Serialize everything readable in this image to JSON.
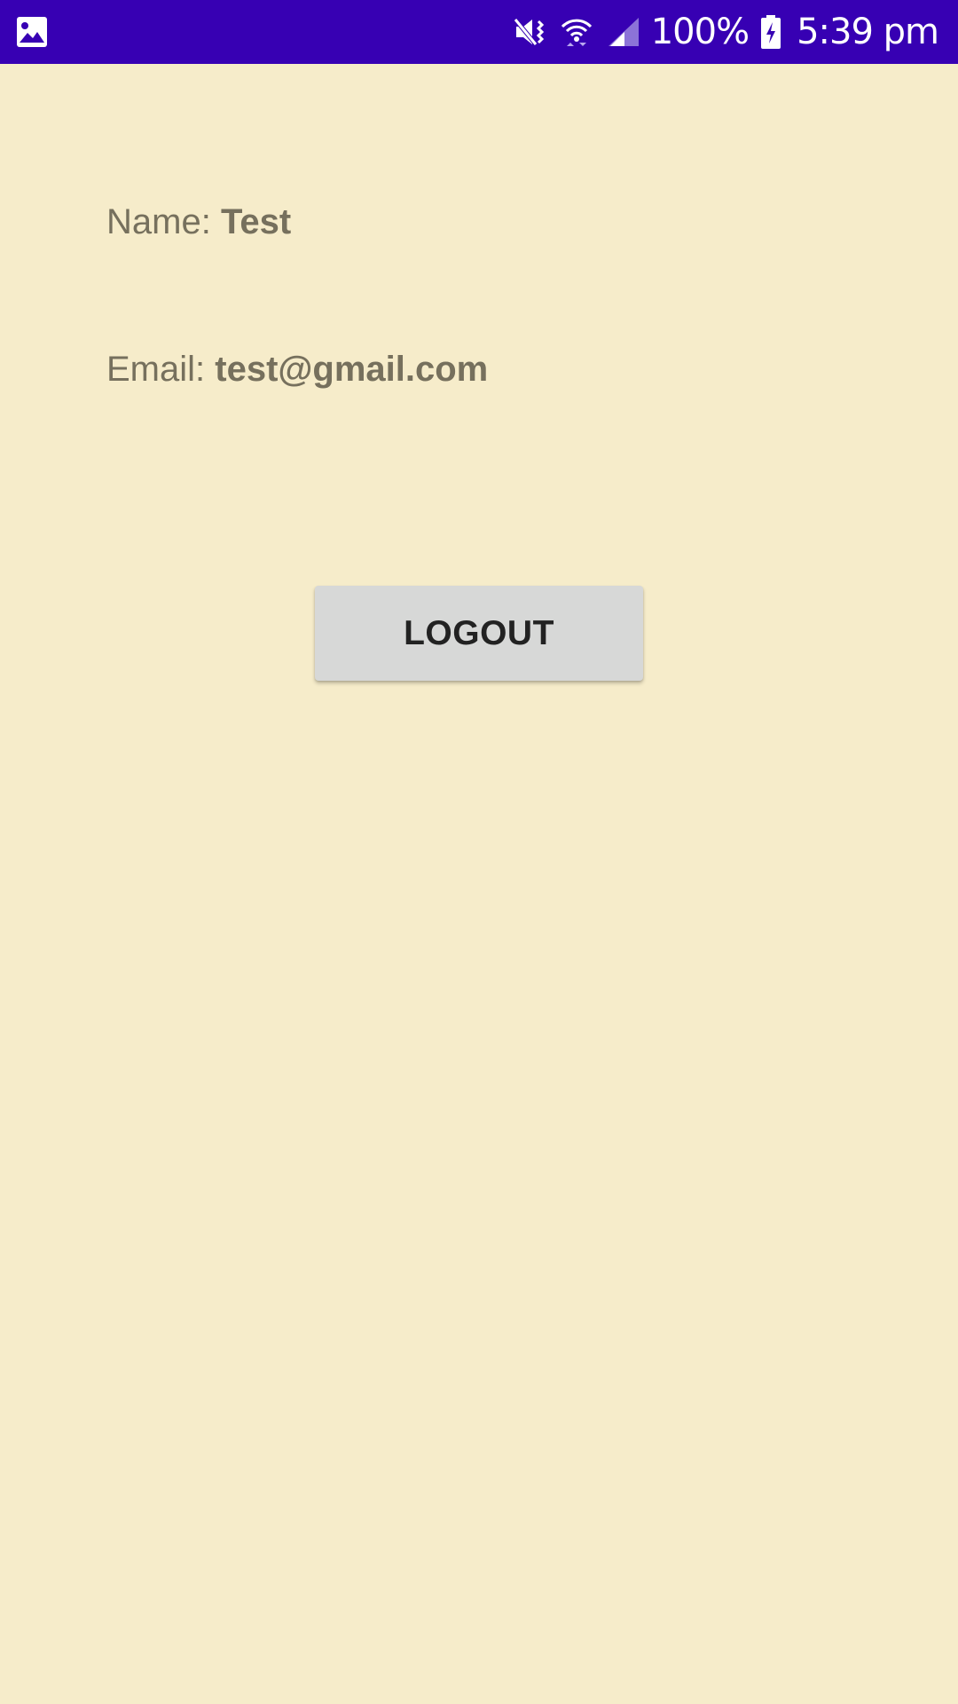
{
  "status_bar": {
    "left_icons": [
      "image-icon"
    ],
    "right_icons": [
      "mute-icon",
      "wifi-icon",
      "signal-icon",
      "battery-charging-icon"
    ],
    "battery_text": "100%",
    "time": "5:39 pm",
    "background_color": "#3700b3"
  },
  "profile": {
    "name_label": "Name: ",
    "name_value": "Test",
    "email_label": "Email: ",
    "email_value": "test@gmail.com"
  },
  "actions": {
    "logout_label": "LOGOUT"
  },
  "colors": {
    "background": "#f6ecca",
    "text": "#76705d",
    "button_bg": "#d7d8d7",
    "button_text": "#222222"
  }
}
